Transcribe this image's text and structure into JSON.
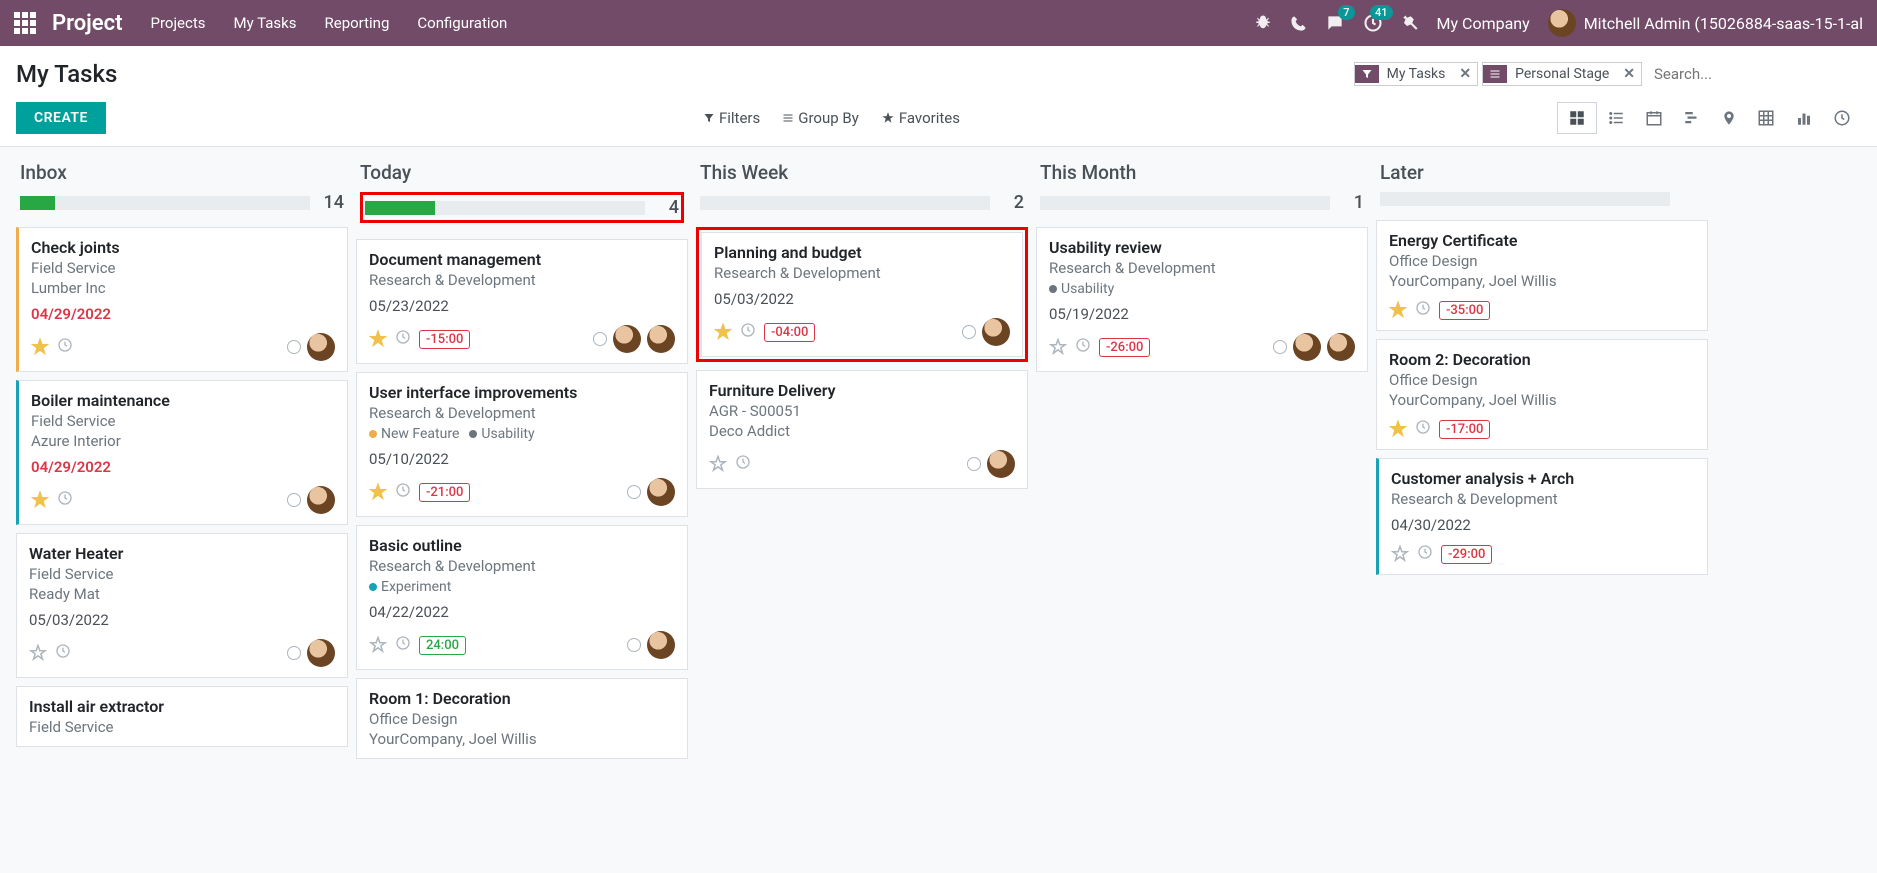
{
  "nav": {
    "app_title": "Project",
    "menu": [
      "Projects",
      "My Tasks",
      "Reporting",
      "Configuration"
    ],
    "messages_badge": "7",
    "activities_badge": "41",
    "company": "My Company",
    "user": "Mitchell Admin (15026884-saas-15-1-al"
  },
  "page": {
    "title": "My Tasks",
    "create_button": "CREATE",
    "search_placeholder": "Search...",
    "facets": [
      {
        "icon": "filter",
        "label": "My Tasks"
      },
      {
        "icon": "bars",
        "label": "Personal Stage"
      }
    ],
    "dropdowns": {
      "filters": "Filters",
      "groupby": "Group By",
      "favorites": "Favorites"
    }
  },
  "columns": [
    {
      "title": "Inbox",
      "count": "14",
      "progress": 12,
      "highlight": false,
      "cards": [
        {
          "title": "Check joints",
          "subs": [
            "Field Service",
            "Lumber Inc"
          ],
          "date": "04/29/2022",
          "overdue": true,
          "star": true,
          "clock": true,
          "pill": null,
          "avatars": 1,
          "status": true,
          "stripe": "orange"
        },
        {
          "title": "Boiler maintenance",
          "subs": [
            "Field Service",
            "Azure Interior"
          ],
          "date": "04/29/2022",
          "overdue": true,
          "star": true,
          "clock": true,
          "pill": null,
          "avatars": 1,
          "status": true,
          "stripe": "teal"
        },
        {
          "title": "Water Heater",
          "subs": [
            "Field Service",
            "Ready Mat"
          ],
          "date": "05/03/2022",
          "overdue": false,
          "star": false,
          "clock": true,
          "pill": null,
          "avatars": 1,
          "status": true,
          "stripe": null
        },
        {
          "title": "Install air extractor",
          "subs": [
            "Field Service"
          ],
          "date": null,
          "overdue": false,
          "star": false,
          "clock": false,
          "pill": null,
          "avatars": 0,
          "status": false,
          "stripe": null
        }
      ]
    },
    {
      "title": "Today",
      "count": "4",
      "progress": 25,
      "highlight": true,
      "cards": [
        {
          "title": "Document management",
          "subs": [
            "Research & Development"
          ],
          "date": "05/23/2022",
          "overdue": false,
          "star": true,
          "clock": true,
          "pill": {
            "text": "-15:00",
            "color": "red"
          },
          "avatars": 2,
          "status": true,
          "stripe": null
        },
        {
          "title": "User interface improvements",
          "subs": [
            "Research & Development"
          ],
          "tags": [
            {
              "label": "New Feature",
              "color": "#f0ad4e"
            },
            {
              "label": "Usability",
              "color": "#6c757d"
            }
          ],
          "date": "05/10/2022",
          "overdue": false,
          "star": true,
          "clock": true,
          "pill": {
            "text": "-21:00",
            "color": "red"
          },
          "avatars": 1,
          "status": true,
          "stripe": null
        },
        {
          "title": "Basic outline",
          "subs": [
            "Research & Development"
          ],
          "tags": [
            {
              "label": "Experiment",
              "color": "#17a2b8"
            }
          ],
          "date": "04/22/2022",
          "overdue": false,
          "star": false,
          "clock": true,
          "pill": {
            "text": "24:00",
            "color": "green"
          },
          "avatars": 1,
          "status": true,
          "stripe": null
        },
        {
          "title": "Room 1: Decoration",
          "subs": [
            "Office Design",
            "YourCompany, Joel Willis"
          ],
          "date": null,
          "overdue": false,
          "star": false,
          "clock": false,
          "pill": null,
          "avatars": 0,
          "status": false,
          "stripe": null
        }
      ]
    },
    {
      "title": "This Week",
      "count": "2",
      "progress": 0,
      "highlight": false,
      "cards": [
        {
          "title": "Planning and budget",
          "subs": [
            "Research & Development"
          ],
          "date": "05/03/2022",
          "overdue": false,
          "star": true,
          "clock": true,
          "pill": {
            "text": "-04:00",
            "color": "red"
          },
          "avatars": 1,
          "status": true,
          "stripe": null,
          "card_highlight": true
        },
        {
          "title": "Furniture Delivery",
          "subs": [
            "AGR - S00051",
            "Deco Addict"
          ],
          "date": null,
          "overdue": false,
          "star": false,
          "clock": true,
          "pill": null,
          "avatars": 1,
          "status": true,
          "stripe": null
        }
      ]
    },
    {
      "title": "This Month",
      "count": "1",
      "progress": 0,
      "highlight": false,
      "cards": [
        {
          "title": "Usability review",
          "subs": [
            "Research & Development"
          ],
          "tags": [
            {
              "label": "Usability",
              "color": "#6c757d"
            }
          ],
          "date": "05/19/2022",
          "overdue": false,
          "star": false,
          "clock": true,
          "pill": {
            "text": "-26:00",
            "color": "red"
          },
          "avatars": 2,
          "status": true,
          "stripe": null
        }
      ]
    },
    {
      "title": "Later",
      "count": "",
      "progress": 0,
      "highlight": false,
      "cards": [
        {
          "title": "Energy Certificate",
          "subs": [
            "Office Design",
            "YourCompany, Joel Willis"
          ],
          "date": null,
          "overdue": false,
          "star": true,
          "clock": true,
          "pill": {
            "text": "-35:00",
            "color": "red"
          },
          "avatars": 0,
          "status": false,
          "stripe": null
        },
        {
          "title": "Room 2: Decoration",
          "subs": [
            "Office Design",
            "YourCompany, Joel Willis"
          ],
          "date": null,
          "overdue": false,
          "star": true,
          "clock": true,
          "pill": {
            "text": "-17:00",
            "color": "red"
          },
          "avatars": 0,
          "status": false,
          "stripe": null
        },
        {
          "title": "Customer analysis + Arch",
          "subs": [
            "Research & Development"
          ],
          "date": "04/30/2022",
          "overdue": false,
          "star": false,
          "clock": true,
          "pill": {
            "text": "-29:00",
            "color": "red"
          },
          "avatars": 0,
          "status": false,
          "stripe": "teal"
        }
      ]
    }
  ]
}
